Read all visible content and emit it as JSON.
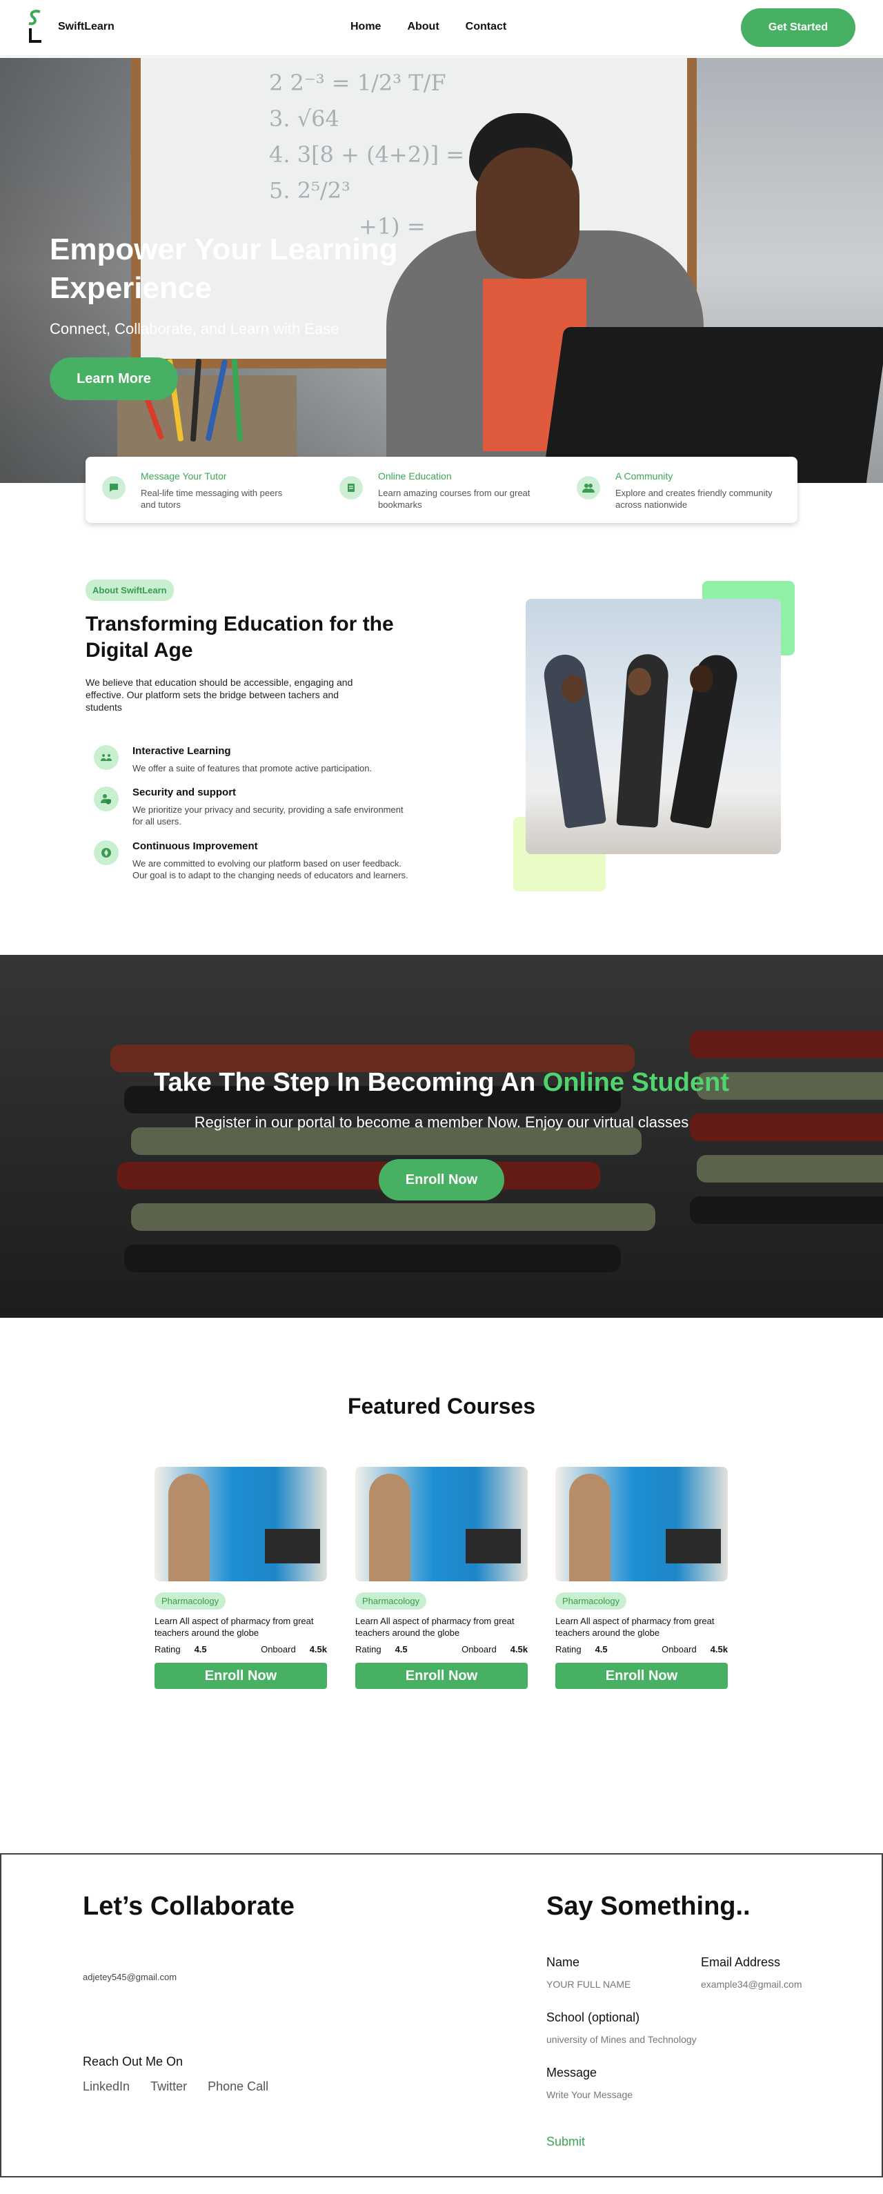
{
  "nav": {
    "logo_letters": "SL",
    "brand": "SwiftLearn",
    "links": [
      "Home",
      "About",
      "Contact"
    ],
    "cta": "Get Started"
  },
  "hero": {
    "title": "Empower Your Learning Experience",
    "subtitle": "Connect, Collaborate, and Learn with Ease",
    "button": "Learn More",
    "board_text": [
      "2  2⁻³ = 1/2³   T/F",
      "3.  √64",
      "4.  3[8 + (4+2)] =",
      "5.  2⁵/2³",
      "+1) ="
    ]
  },
  "features": [
    {
      "icon": "chat-icon",
      "title": "Message Your Tutor",
      "desc": "Real-life time messaging with peers and tutors"
    },
    {
      "icon": "book-icon",
      "title": "Online Education",
      "desc": "Learn amazing courses from our great bookmarks"
    },
    {
      "icon": "community-icon",
      "title": "A Community",
      "desc": "Explore and creates friendly community across nationwide"
    }
  ],
  "about": {
    "badge": "About SwiftLearn",
    "title": "Transforming Education for the Digital Age",
    "text": "We believe that education should be accessible, engaging and effective. Our platform sets the bridge between tachers and students",
    "items": [
      {
        "icon": "people-icon",
        "title": "Interactive Learning",
        "desc": "We offer a suite of features that promote active participation."
      },
      {
        "icon": "user-shield-icon",
        "title": "Security and support",
        "desc": "We prioritize your privacy and security, providing a safe environment for all users."
      },
      {
        "icon": "improvement-icon",
        "title": "Continuous Improvement",
        "desc": "We are committed to evolving our platform based on user feedback. Our goal is to adapt to the changing needs of educators and learners."
      }
    ]
  },
  "cta": {
    "title_main": "Take The Step In Becoming An ",
    "title_highlight": "Online Student",
    "subtitle": "Register in our portal to become a member Now. Enjoy our virtual classes",
    "button": "Enroll Now"
  },
  "courses": {
    "title": "Featured Courses",
    "items": [
      {
        "badge": "Pharmacology",
        "desc": "Learn All aspect of pharmacy from great teachers around the globe",
        "rating_label": "Rating",
        "rating": "4.5",
        "onboard_label": "Onboard",
        "onboard": "4.5k",
        "button": "Enroll Now"
      },
      {
        "badge": "Pharmacology",
        "desc": "Learn All aspect of pharmacy from great teachers around the globe",
        "rating_label": "Rating",
        "rating": "4.5",
        "onboard_label": "Onboard",
        "onboard": "4.5k",
        "button": "Enroll Now"
      },
      {
        "badge": "Pharmacology",
        "desc": "Learn All aspect of pharmacy from great teachers around the globe",
        "rating_label": "Rating",
        "rating": "4.5",
        "onboard_label": "Onboard",
        "onboard": "4.5k",
        "button": "Enroll Now"
      }
    ]
  },
  "footer": {
    "left_title": "Let’s Collaborate",
    "email": "adjetey545@gmail.com",
    "reach_title": "Reach Out Me On",
    "reach_links": [
      "LinkedIn",
      "Twitter",
      "Phone Call"
    ],
    "right_title": "Say Something..",
    "name_label": "Name",
    "name_placeholder": "YOUR FULL NAME",
    "email_label": "Email Address",
    "email_placeholder": "example34@gmail.com",
    "school_label": "School (optional)",
    "school_placeholder": "university of Mines and Technology",
    "message_label": "Message",
    "message_placeholder": "Write Your Message",
    "submit": "Submit"
  },
  "colors": {
    "accent": "#48b063",
    "accent_light": "#c8efd0",
    "highlight_text": "#4fd46e"
  }
}
